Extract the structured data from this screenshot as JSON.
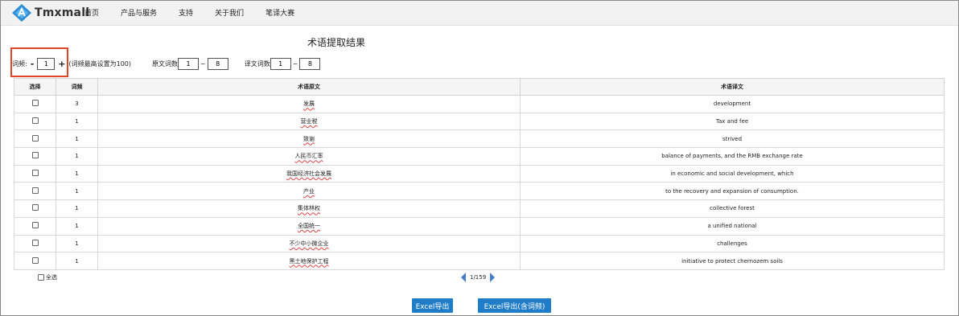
{
  "header": {
    "logo_text": "Tmxmall",
    "nav": [
      "首页",
      "产品与服务",
      "支持",
      "关于我们",
      "笔译大赛"
    ]
  },
  "page_title": "术语提取结果",
  "filters": {
    "freq_label": "词频:",
    "freq_minus": "-",
    "freq_value": "1",
    "freq_plus": "+",
    "freq_note": "(词频最高设置为100)",
    "src_words_label": "原文词数",
    "src_min": "1",
    "src_max": "8",
    "tgt_words_label": "译文词数",
    "tgt_min": "1",
    "tgt_max": "8",
    "range_sep": "~"
  },
  "table": {
    "headers": [
      "选择",
      "词频",
      "术语原文",
      "术语译文"
    ],
    "rows": [
      {
        "freq": "3",
        "source": "发展",
        "target": "development"
      },
      {
        "freq": "1",
        "source": "营业税",
        "target": "Tax and fee"
      },
      {
        "freq": "1",
        "source": "致谢",
        "target": "strived"
      },
      {
        "freq": "1",
        "source": "人民币汇率",
        "target": "balance of payments, and the RMB exchange rate"
      },
      {
        "freq": "1",
        "source": "我国经济社会发展",
        "target": "in economic and social development, which"
      },
      {
        "freq": "1",
        "source": "产业",
        "target": "to the recovery and expansion of consumption."
      },
      {
        "freq": "1",
        "source": "集体林权",
        "target": "collective forest"
      },
      {
        "freq": "1",
        "source": "全国统一",
        "target": "a unified national"
      },
      {
        "freq": "1",
        "source": "不少中小微企业",
        "target": "challenges"
      },
      {
        "freq": "1",
        "source": "黑土地保护工程",
        "target": "initiative to protect chernozem soils"
      }
    ]
  },
  "select_all_label": "全选",
  "pager": {
    "text": "1/159"
  },
  "buttons": {
    "export": "Excel导出",
    "export_with_freq": "Excel导出(含词频)"
  },
  "colors": {
    "accent": "#1e7cc8",
    "highlight": "#e0452a",
    "pager_arrow": "#4a7fc7"
  }
}
